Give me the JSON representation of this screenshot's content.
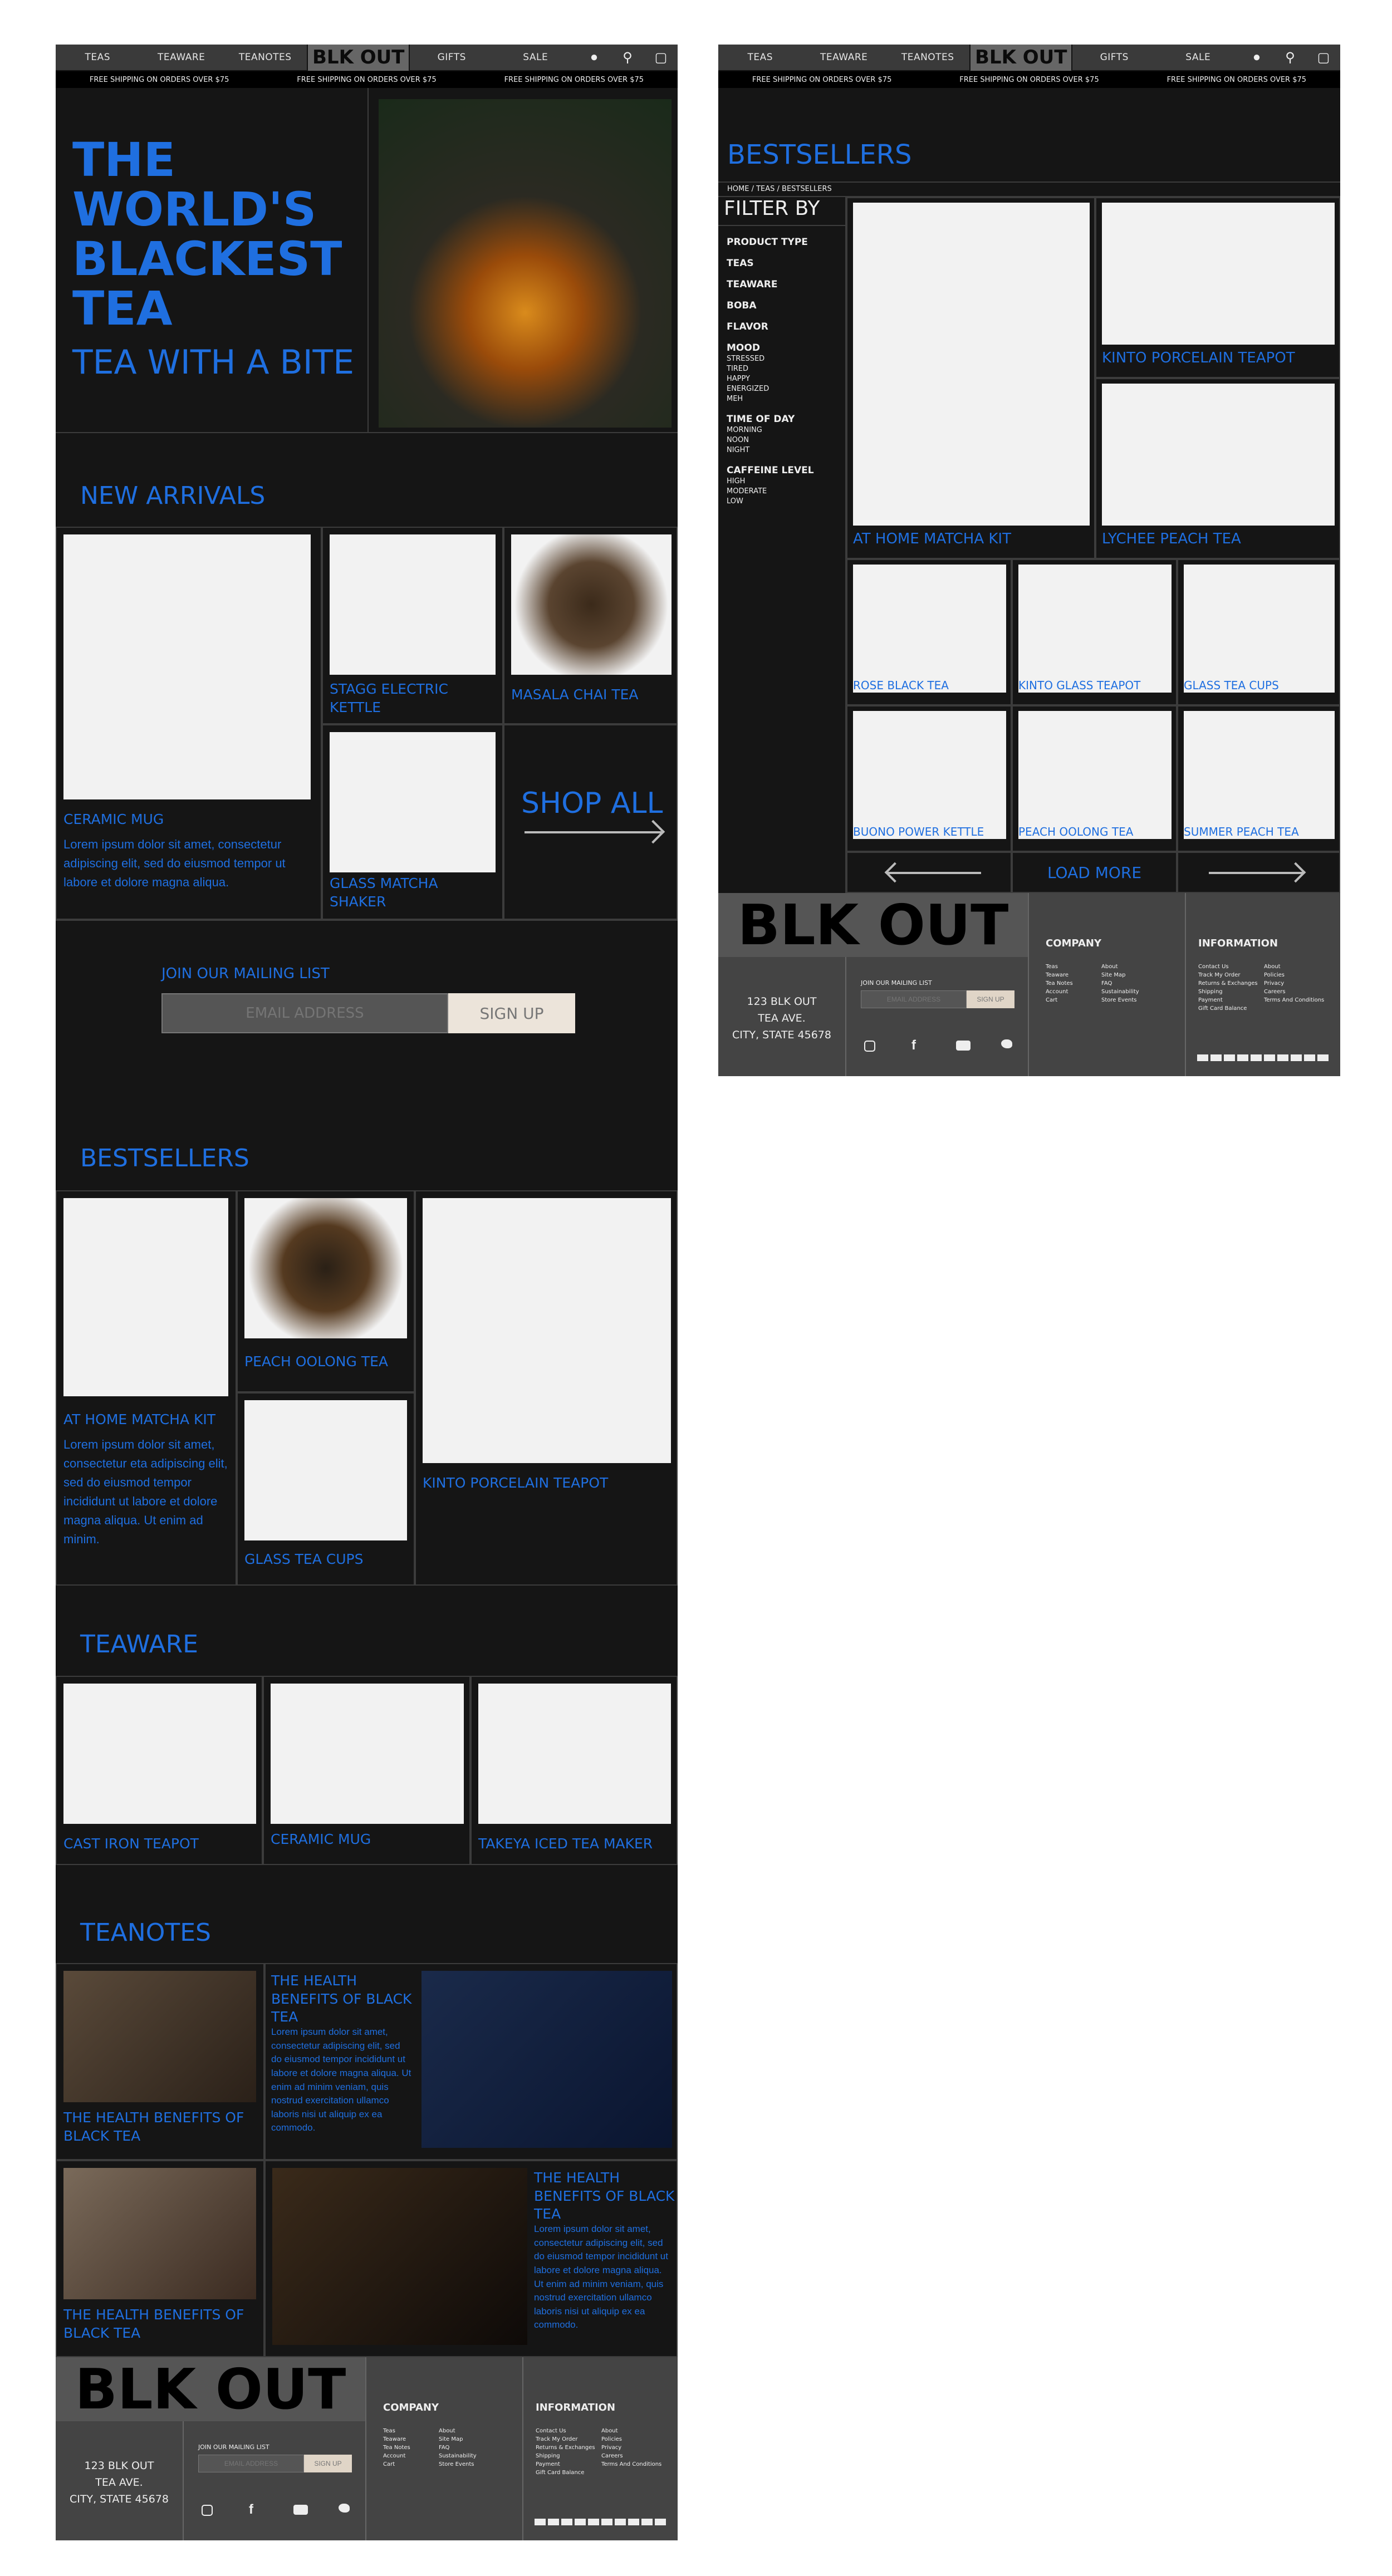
{
  "nav": {
    "teas": "TEAS",
    "teaware": "TEAWARE",
    "teanotes": "TEANOTES",
    "logo": "BLK OUT",
    "gifts": "GIFTS",
    "sale": "SALE"
  },
  "shipping": "FREE SHIPPING ON ORDERS OVER $75",
  "hero": {
    "line1": "THE",
    "line2": "WORLD'S",
    "line3": "BLACKEST",
    "line4": "TEA",
    "tagline": "TEA WITH A BITE"
  },
  "new_arrivals": {
    "title": "NEW ARRIVALS",
    "items": [
      "CERAMIC MUG",
      "STAGG ELECTRIC KETTLE",
      "MASALA CHAI TEA",
      "GLASS MATCHA SHAKER"
    ],
    "shop_all": "SHOP ALL"
  },
  "lorem_short": "Lorem ipsum dolor sit amet, consectetur adipiscing elit, sed do eiusmod tempor ut labore et dolore magna aliqua.",
  "lorem_best": "Lorem ipsum dolor sit amet, consectetur eta adipiscing elit, sed do eiusmod tempor incididunt ut labore et dolore magna aliqua. Ut enim ad minim.",
  "mailing": {
    "label": "JOIN OUR MAILING LIST",
    "placeholder": "EMAIL ADDRESS",
    "button": "SIGN UP"
  },
  "bestsellers": {
    "title": "BESTSELLERS",
    "items": [
      "PEACH OOLONG TEA",
      "AT HOME MATCHA KIT",
      "GLASS TEA CUPS",
      "KINTO PORCELAIN TEAPOT"
    ]
  },
  "teaware": {
    "title": "TEAWARE",
    "items": [
      "CAST IRON TEAPOT",
      "CERAMIC MUG",
      "TAKEYA ICED TEA MAKER"
    ]
  },
  "teanotes": {
    "title": "TEANOTES",
    "article": "THE HEALTH BENEFITS OF BLACK TEA",
    "body": "Lorem ipsum dolor sit amet, consectetur adipiscing elit, sed do eiusmod tempor incididunt ut labore et dolore magna aliqua. Ut enim ad minim veniam, quis nostrud exercitation ullamco laboris nisi ut aliquip ex ea commodo."
  },
  "footer": {
    "logo": "BLK OUT",
    "addr1": "123 BLK OUT",
    "addr2": "TEA AVE.",
    "addr3": "CITY, STATE 45678",
    "company": "COMPANY",
    "information": "INFORMATION",
    "company_col1": [
      "Teas",
      "Teaware",
      "Tea Notes",
      "Account",
      "Cart"
    ],
    "company_col2": [
      "About",
      "Site Map",
      "FAQ",
      "Sustainability",
      "Store Events"
    ],
    "info_col1": [
      "Contact Us",
      "Track My Order",
      "Returns & Exchanges",
      "Shipping",
      "Payment",
      "Gift Card Balance"
    ],
    "info_col2": [
      "About",
      "Policies",
      "Privacy",
      "Careers",
      "Terms And Conditions"
    ]
  },
  "catalog": {
    "title": "BESTSELLERS",
    "breadcrumb": "HOME / TEAS / BESTSELLERS",
    "filter_title": "FILTER BY",
    "filters": [
      {
        "h": "PRODUCT TYPE",
        "o": []
      },
      {
        "h": "TEAS",
        "o": []
      },
      {
        "h": "TEAWARE",
        "o": []
      },
      {
        "h": "BOBA",
        "o": []
      },
      {
        "h": "FLAVOR",
        "o": []
      },
      {
        "h": "MOOD",
        "o": [
          "STRESSED",
          "TIRED",
          "HAPPY",
          "ENERGIZED",
          "MEH"
        ]
      },
      {
        "h": "TIME OF DAY",
        "o": [
          "MORNING",
          "NOON",
          "NIGHT"
        ]
      },
      {
        "h": "CAFFEINE LEVEL",
        "o": [
          "HIGH",
          "MODERATE",
          "LOW"
        ]
      }
    ],
    "products": [
      "AT HOME MATCHA KIT",
      "KINTO PORCELAIN TEAPOT",
      "LYCHEE PEACH TEA",
      "ROSE BLACK TEA",
      "KINTO GLASS TEAPOT",
      "GLASS TEA CUPS",
      "BUONO POWER KETTLE",
      "PEACH OOLONG TEA",
      "SUMMER PEACH TEA"
    ],
    "load_more": "LOAD MORE"
  }
}
